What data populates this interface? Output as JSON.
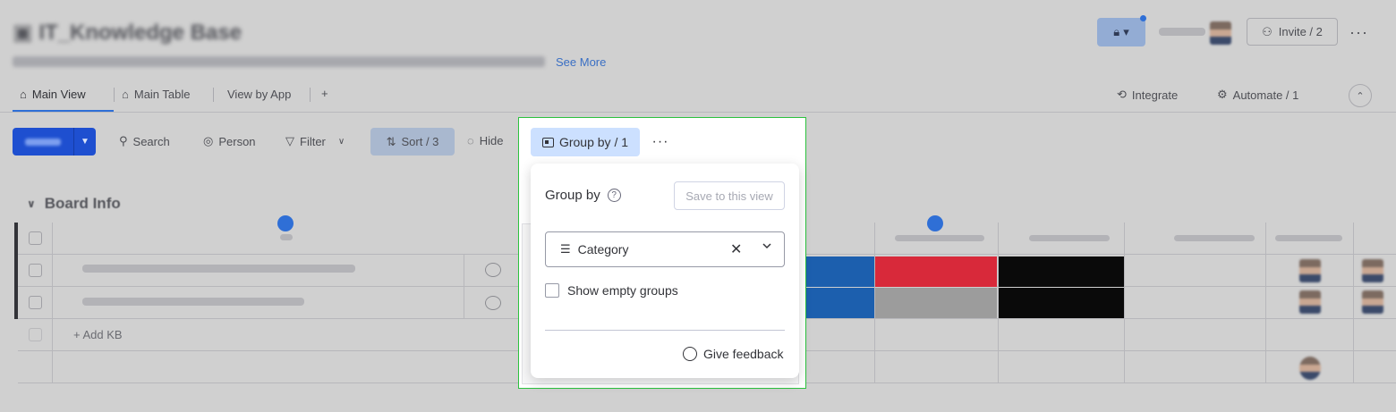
{
  "header": {
    "see_more": "See More",
    "invite_label": "Invite / 2"
  },
  "tabs": [
    {
      "label": "Main View",
      "icon": "home-icon"
    },
    {
      "label": "Main Table",
      "icon": "table-icon"
    },
    {
      "label": "View by App",
      "icon": ""
    },
    {
      "label": "+",
      "icon": ""
    }
  ],
  "right_actions": {
    "integrate": "Integrate",
    "automate": "Automate / 1"
  },
  "toolbar": {
    "search": "Search",
    "person": "Person",
    "filter": "Filter",
    "sort": "Sort / 3",
    "hide": "Hide",
    "group_by": "Group by / 1"
  },
  "group": {
    "title": "Board Info",
    "add_item": "+ Add KB"
  },
  "popup": {
    "title": "Group by",
    "save_view": "Save to this view",
    "selected_column": "Category",
    "show_empty_label": "Show empty groups",
    "show_empty_checked": false,
    "feedback": "Give feedback"
  },
  "colors": {
    "accent": "#2f6fd6",
    "group_by_bg": "#cce0ff",
    "highlight_border": "#2cc23e"
  }
}
